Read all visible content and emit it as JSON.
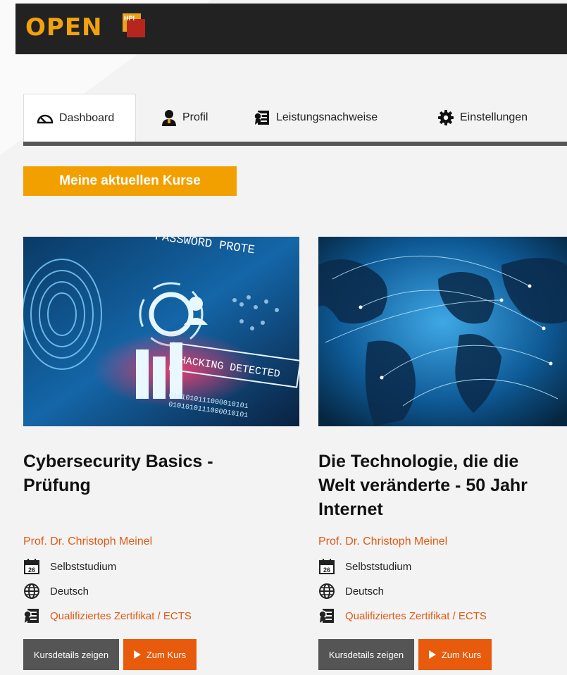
{
  "brand": {
    "logo_text": "OPEN",
    "logo_badge": "HPI"
  },
  "tabs": [
    {
      "label": "Dashboard",
      "icon": "dashboard-gauge-icon",
      "active": true
    },
    {
      "label": "Profil",
      "icon": "user-icon",
      "active": false
    },
    {
      "label": "Leistungsnachweise",
      "icon": "certificate-icon",
      "active": false
    },
    {
      "label": "Einstellungen",
      "icon": "gear-icon",
      "active": false
    }
  ],
  "section": {
    "title": "Meine aktuellen Kurse"
  },
  "courses": [
    {
      "title_line1": "Cybersecurity Basics -",
      "title_line2": "Prüfung",
      "title_line3": "",
      "image_caption_1": "PASSWORD PROTE",
      "image_caption_2": "HACKING DETECTED",
      "teacher": "Prof. Dr. Christoph Meinel",
      "format": "Selbststudium",
      "calendar_day": "26",
      "language": "Deutsch",
      "certificate": "Qualifiziertes Zertifikat / ECTS",
      "details_button": "Kursdetails zeigen",
      "go_button": "Zum Kurs"
    },
    {
      "title_line1": "Die Technologie, die die",
      "title_line2": "Welt veränderte - 50 Jahr",
      "title_line3": "Internet",
      "teacher": "Prof. Dr. Christoph Meinel",
      "format": "Selbststudium",
      "calendar_day": "26",
      "language": "Deutsch",
      "certificate": "Qualifiziertes Zertifikat / ECTS",
      "details_button": "Kursdetails zeigen",
      "go_button": "Zum Kurs"
    }
  ],
  "colors": {
    "topbar": "#222222",
    "brand_orange": "#f2a20d",
    "accent_orange": "#e85a0c",
    "link_orange": "#e05a14",
    "section_bg": "#f2a000"
  }
}
